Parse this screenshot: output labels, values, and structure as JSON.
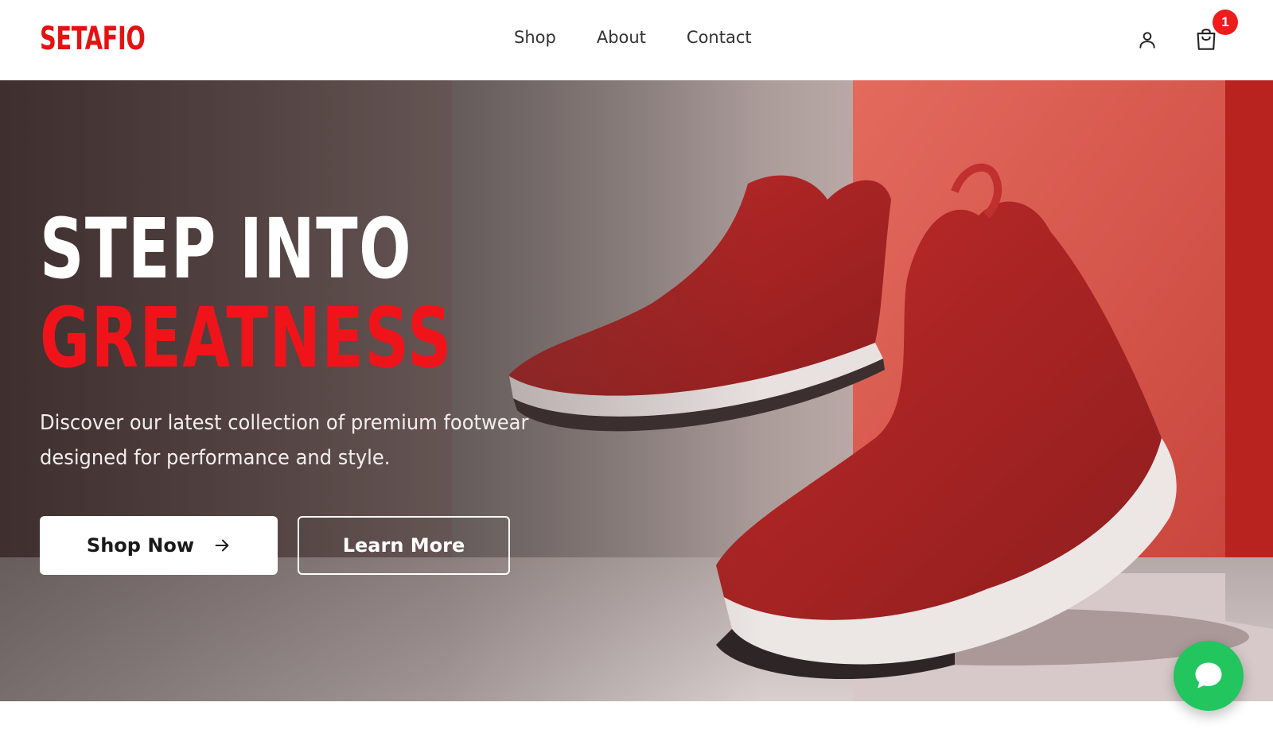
{
  "brand": {
    "logo_text": "SETAFIO",
    "accent_color": "#e41212"
  },
  "nav": {
    "items": [
      {
        "label": "Shop"
      },
      {
        "label": "About"
      },
      {
        "label": "Contact"
      }
    ]
  },
  "header_actions": {
    "user_icon": "user-icon",
    "cart_icon": "shopping-bag-icon",
    "cart_count": "1",
    "badge_color": "#ee1c1c"
  },
  "hero": {
    "title_line_1": "STEP INTO",
    "title_line_2": "GREATNESS",
    "title_line_2_color": "#f0141a",
    "description": "Discover our latest collection of premium footwear designed for performance and style.",
    "primary_button": {
      "label": "Shop Now",
      "icon": "arrow-right-icon"
    },
    "secondary_button": {
      "label": "Learn More"
    },
    "image_subject": "red running sneakers"
  },
  "chat": {
    "icon": "chat-bubble-icon",
    "color": "#22c55e"
  }
}
